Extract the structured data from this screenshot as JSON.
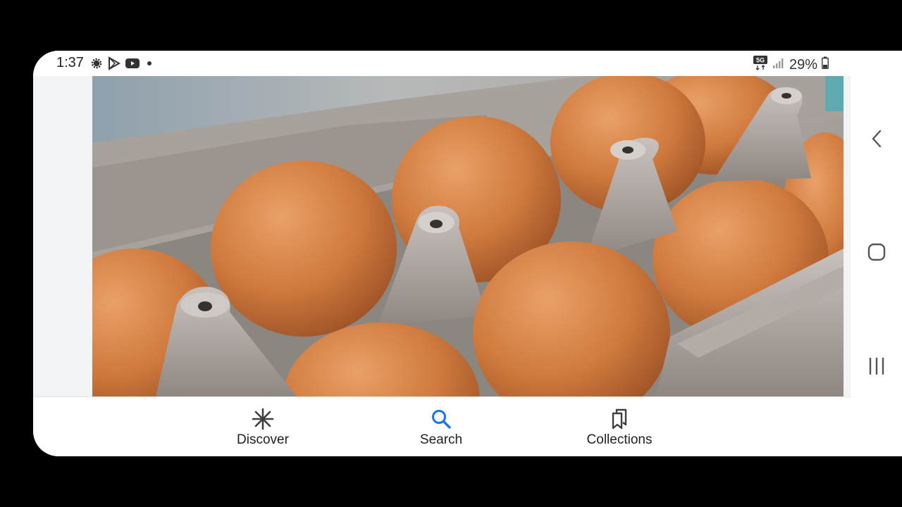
{
  "status_bar": {
    "time": "1:37",
    "network": "5G",
    "battery": "29%",
    "left_icons": [
      "settings-gear-icon",
      "play-store-icon",
      "youtube-icon",
      "dot-icon"
    ]
  },
  "image": {
    "subject": "brown eggs in cardboard carton"
  },
  "bottom_nav": {
    "tabs": [
      {
        "label": "Discover",
        "icon": "asterisk-icon"
      },
      {
        "label": "Search",
        "icon": "search-icon",
        "active": true
      },
      {
        "label": "Collections",
        "icon": "bookmarks-icon"
      }
    ]
  },
  "system_nav": [
    "back-icon",
    "home-icon",
    "recents-icon"
  ],
  "colors": {
    "accent": "#1a73e8",
    "text": "#202124",
    "background": "#000000"
  }
}
